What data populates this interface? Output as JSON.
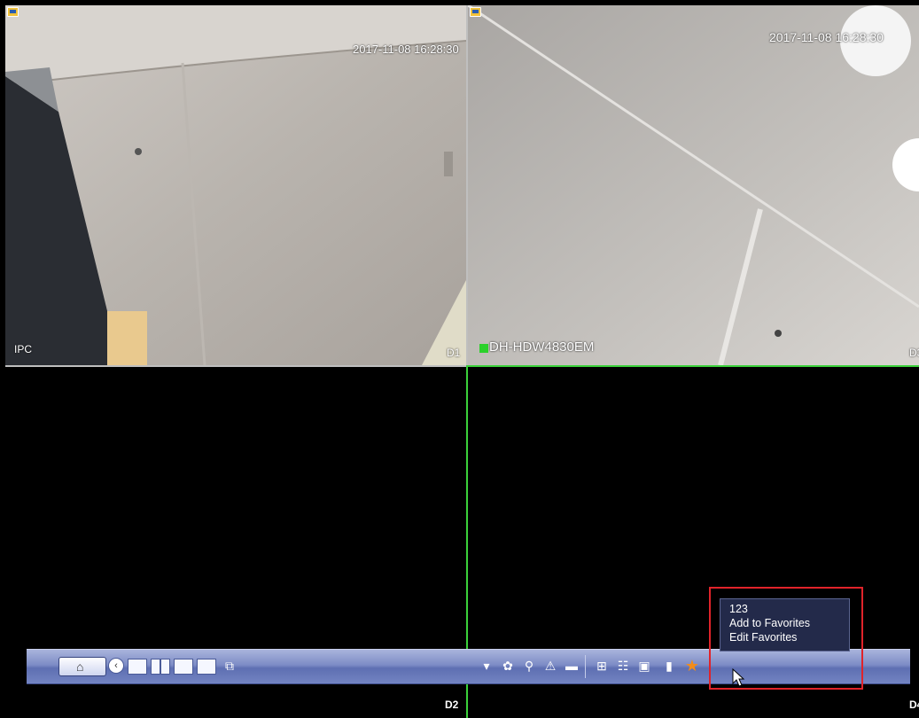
{
  "channels": [
    {
      "id": "D1",
      "timestamp": "2017-11-08 16:28:30",
      "label": "IPC"
    },
    {
      "id": "D3",
      "timestamp": "2017-11-08 16:28:30",
      "label": "DH-HDW4830EM"
    },
    {
      "id": "D2"
    },
    {
      "id": "D4"
    }
  ],
  "popup": {
    "items": [
      "123",
      "Add to Favorites",
      "Edit Favorites"
    ]
  },
  "toolbar": {
    "left_icons": [
      "home-icon",
      "back-icon",
      "single-view-icon",
      "quad-view-icon",
      "eight-view-icon",
      "nine-view-icon",
      "layout-icon"
    ],
    "right_icons": [
      "ptz-icon",
      "color-icon",
      "search-icon",
      "alarm-icon",
      "camera-icon",
      "network-icon",
      "hdd-icon",
      "disk-icon",
      "usb-icon",
      "favorites-star-icon"
    ]
  },
  "colors": {
    "accent": "#3ad13a",
    "highlight": "#e0232a",
    "star": "#f28c1a"
  }
}
